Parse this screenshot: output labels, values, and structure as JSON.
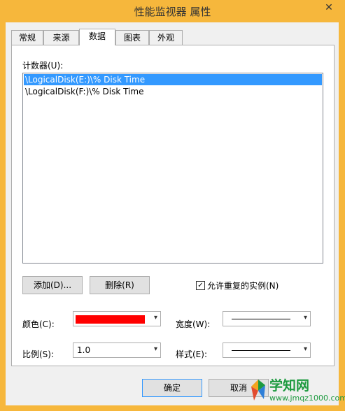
{
  "window": {
    "title": "性能监视器 属性",
    "close_glyph": "✕"
  },
  "tabs": [
    {
      "label": "常规",
      "active": false
    },
    {
      "label": "来源",
      "active": false
    },
    {
      "label": "数据",
      "active": true
    },
    {
      "label": "图表",
      "active": false
    },
    {
      "label": "外观",
      "active": false
    }
  ],
  "data_tab": {
    "counters_label": "计数器(U):",
    "counters": [
      {
        "name": "\\LogicalDisk(E:)\\% Disk Time",
        "selected": true
      },
      {
        "name": "\\LogicalDisk(F:)\\% Disk Time",
        "selected": false
      }
    ],
    "add_button": "添加(D)...",
    "remove_button": "删除(R)",
    "allow_duplicates": {
      "label": "允许重复的实例(N)",
      "checked": true,
      "check_glyph": "✓"
    },
    "color": {
      "label": "颜色(C):",
      "value": "#ff0000"
    },
    "width": {
      "label": "宽度(W):"
    },
    "scale": {
      "label": "比例(S):",
      "value": "1.0"
    },
    "style": {
      "label": "样式(E):"
    },
    "dropdown_arrow": "▾"
  },
  "footer": {
    "ok_button": "确定",
    "cancel_button": "取消"
  },
  "watermark": {
    "title": "学知网",
    "url": "www.jmqz1000.com"
  },
  "colors": {
    "title_bar": "#f6b73c",
    "selection": "#3399ff",
    "watermark": "#1d9a3f"
  }
}
